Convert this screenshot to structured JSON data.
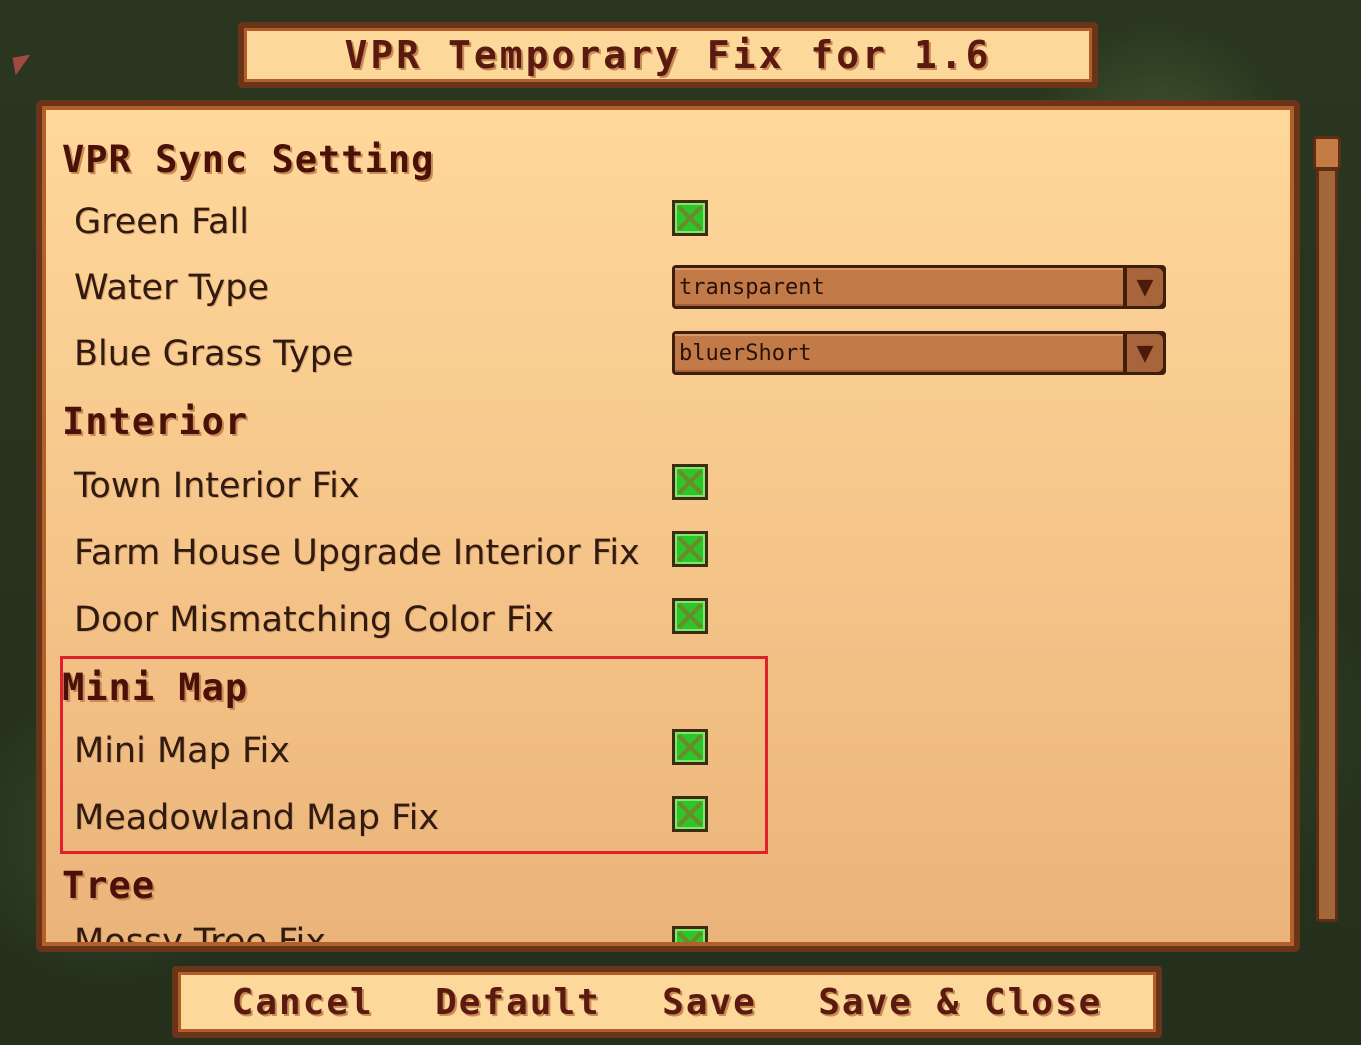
{
  "window": {
    "title": "VPR Temporary Fix for 1.6"
  },
  "sections": [
    {
      "header": "VPR Sync Setting",
      "rows": [
        {
          "label": "Green Fall",
          "type": "checkbox",
          "checked": true
        },
        {
          "label": "Water Type",
          "type": "dropdown",
          "value": "transparent"
        },
        {
          "label": "Blue Grass Type",
          "type": "dropdown",
          "value": "bluerShort"
        }
      ]
    },
    {
      "header": "Interior",
      "rows": [
        {
          "label": "Town Interior Fix",
          "type": "checkbox",
          "checked": true
        },
        {
          "label": "Farm House Upgrade Interior Fix",
          "type": "checkbox",
          "checked": true
        },
        {
          "label": "Door Mismatching Color Fix",
          "type": "checkbox",
          "checked": true
        }
      ]
    },
    {
      "header": "Mini Map",
      "rows": [
        {
          "label": "Mini Map Fix",
          "type": "checkbox",
          "checked": true
        },
        {
          "label": "Meadowland Map Fix",
          "type": "checkbox",
          "checked": true
        }
      ]
    },
    {
      "header": "Tree",
      "rows": [
        {
          "label": "Mossy Tree Fix",
          "type": "checkbox",
          "checked": true
        }
      ]
    }
  ],
  "buttons": {
    "cancel": "Cancel",
    "default": "Default",
    "save": "Save",
    "save_close": "Save & Close"
  },
  "icons": {
    "checkbox_checked": "check-x-icon",
    "dropdown_arrow": "chevron-down-icon"
  },
  "colors": {
    "panel_bg": "#f5c489",
    "frame": "#6a3418",
    "checkbox_green": "#2dc52a",
    "highlight": "#e0202a",
    "text_dark": "#311a10"
  }
}
